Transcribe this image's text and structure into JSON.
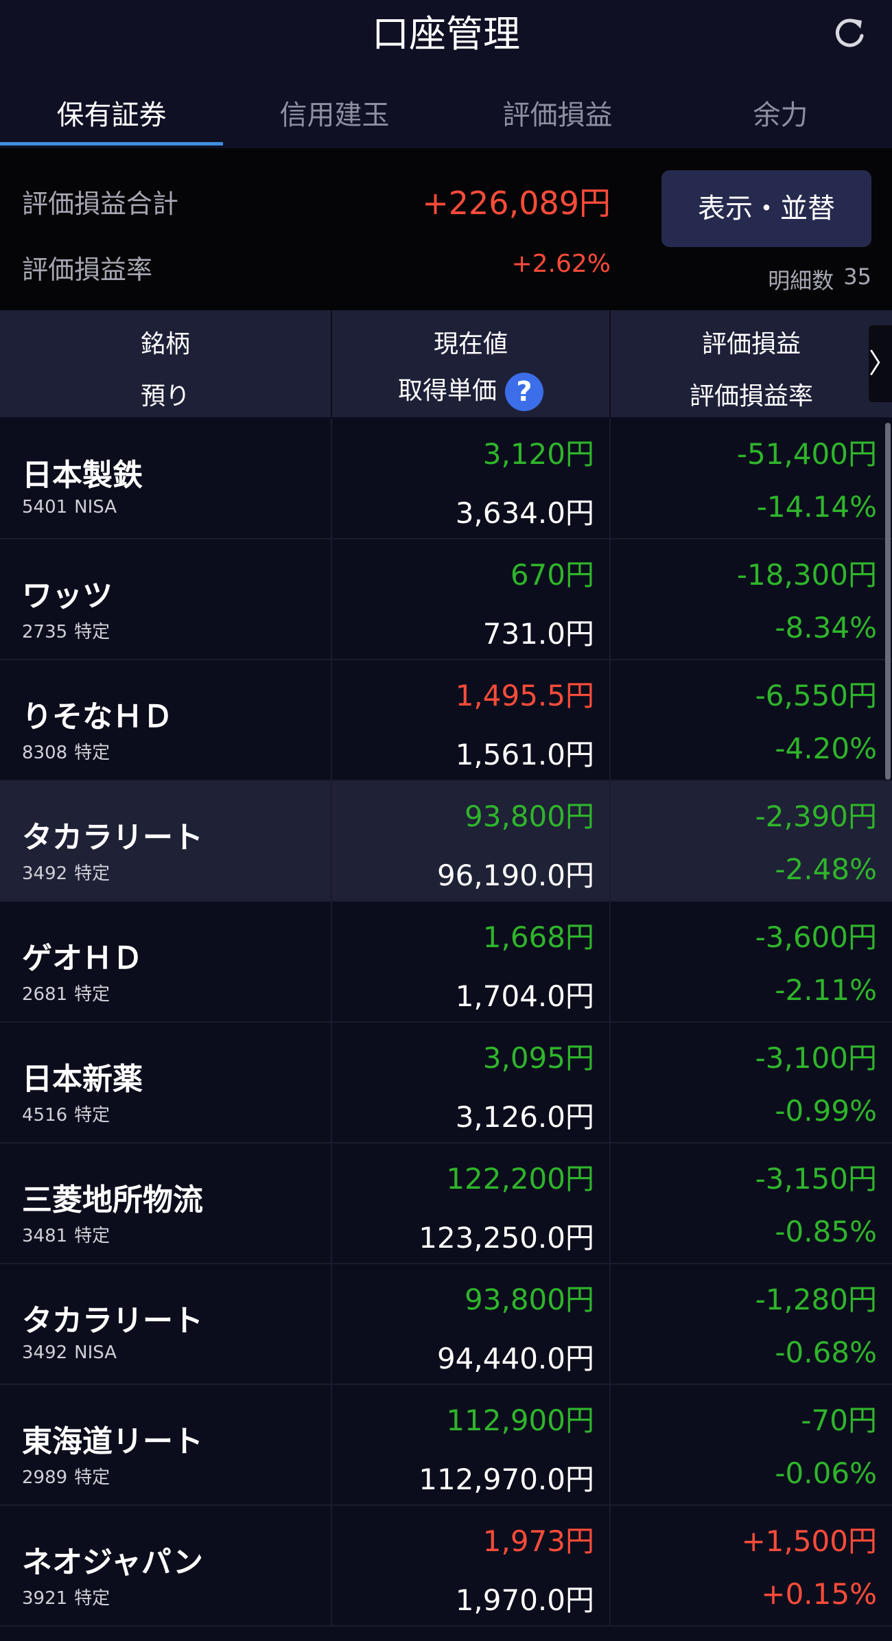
{
  "header": {
    "title": "口座管理",
    "refresh_icon": "refresh-icon"
  },
  "tabs": [
    {
      "label": "保有証券",
      "active": true
    },
    {
      "label": "信用建玉",
      "active": false
    },
    {
      "label": "評価損益",
      "active": false
    },
    {
      "label": "余力",
      "active": false
    }
  ],
  "summary": {
    "total_label": "評価損益合計",
    "total_value": "+226,089円",
    "rate_label": "評価損益率",
    "rate_value": "+2.62%",
    "display_button": "表示・並替",
    "count_label": "明細数",
    "count_value": "35"
  },
  "columns": {
    "col1_line1": "銘柄",
    "col1_line2": "預り",
    "col2_line1": "現在値",
    "col2_line2": "取得単価",
    "col3_line1": "評価損益",
    "col3_line2": "評価損益率",
    "help_icon": "?",
    "more_icon": "〉"
  },
  "colors": {
    "positive": "#ff4c3a",
    "negative": "#2fb52b",
    "accent": "#3f8fe0",
    "background": "#0c0d1c"
  },
  "holdings": [
    {
      "name": "日本製鉄",
      "code": "5401",
      "account": "NISA",
      "price": "3,120円",
      "cost": "3,634.0円",
      "pl": "-51,400円",
      "pl_rate": "-14.14%",
      "price_dir": "neg",
      "pl_dir": "neg",
      "highlight": false
    },
    {
      "name": "ワッツ",
      "code": "2735",
      "account": "特定",
      "price": "670円",
      "cost": "731.0円",
      "pl": "-18,300円",
      "pl_rate": "-8.34%",
      "price_dir": "neg",
      "pl_dir": "neg",
      "highlight": false
    },
    {
      "name": "りそなＨＤ",
      "code": "8308",
      "account": "特定",
      "price": "1,495.5円",
      "cost": "1,561.0円",
      "pl": "-6,550円",
      "pl_rate": "-4.20%",
      "price_dir": "pos",
      "pl_dir": "neg",
      "highlight": false
    },
    {
      "name": "タカラリート",
      "code": "3492",
      "account": "特定",
      "price": "93,800円",
      "cost": "96,190.0円",
      "pl": "-2,390円",
      "pl_rate": "-2.48%",
      "price_dir": "neg",
      "pl_dir": "neg",
      "highlight": true
    },
    {
      "name": "ゲオＨＤ",
      "code": "2681",
      "account": "特定",
      "price": "1,668円",
      "cost": "1,704.0円",
      "pl": "-3,600円",
      "pl_rate": "-2.11%",
      "price_dir": "neg",
      "pl_dir": "neg",
      "highlight": false
    },
    {
      "name": "日本新薬",
      "code": "4516",
      "account": "特定",
      "price": "3,095円",
      "cost": "3,126.0円",
      "pl": "-3,100円",
      "pl_rate": "-0.99%",
      "price_dir": "neg",
      "pl_dir": "neg",
      "highlight": false
    },
    {
      "name": "三菱地所物流",
      "code": "3481",
      "account": "特定",
      "price": "122,200円",
      "cost": "123,250.0円",
      "pl": "-3,150円",
      "pl_rate": "-0.85%",
      "price_dir": "neg",
      "pl_dir": "neg",
      "highlight": false
    },
    {
      "name": "タカラリート",
      "code": "3492",
      "account": "NISA",
      "price": "93,800円",
      "cost": "94,440.0円",
      "pl": "-1,280円",
      "pl_rate": "-0.68%",
      "price_dir": "neg",
      "pl_dir": "neg",
      "highlight": false
    },
    {
      "name": "東海道リート",
      "code": "2989",
      "account": "特定",
      "price": "112,900円",
      "cost": "112,970.0円",
      "pl": "-70円",
      "pl_rate": "-0.06%",
      "price_dir": "neg",
      "pl_dir": "neg",
      "highlight": false
    },
    {
      "name": "ネオジャパン",
      "code": "3921",
      "account": "特定",
      "price": "1,973円",
      "cost": "1,970.0円",
      "pl": "+1,500円",
      "pl_rate": "+0.15%",
      "price_dir": "pos",
      "pl_dir": "pos",
      "highlight": false
    }
  ]
}
